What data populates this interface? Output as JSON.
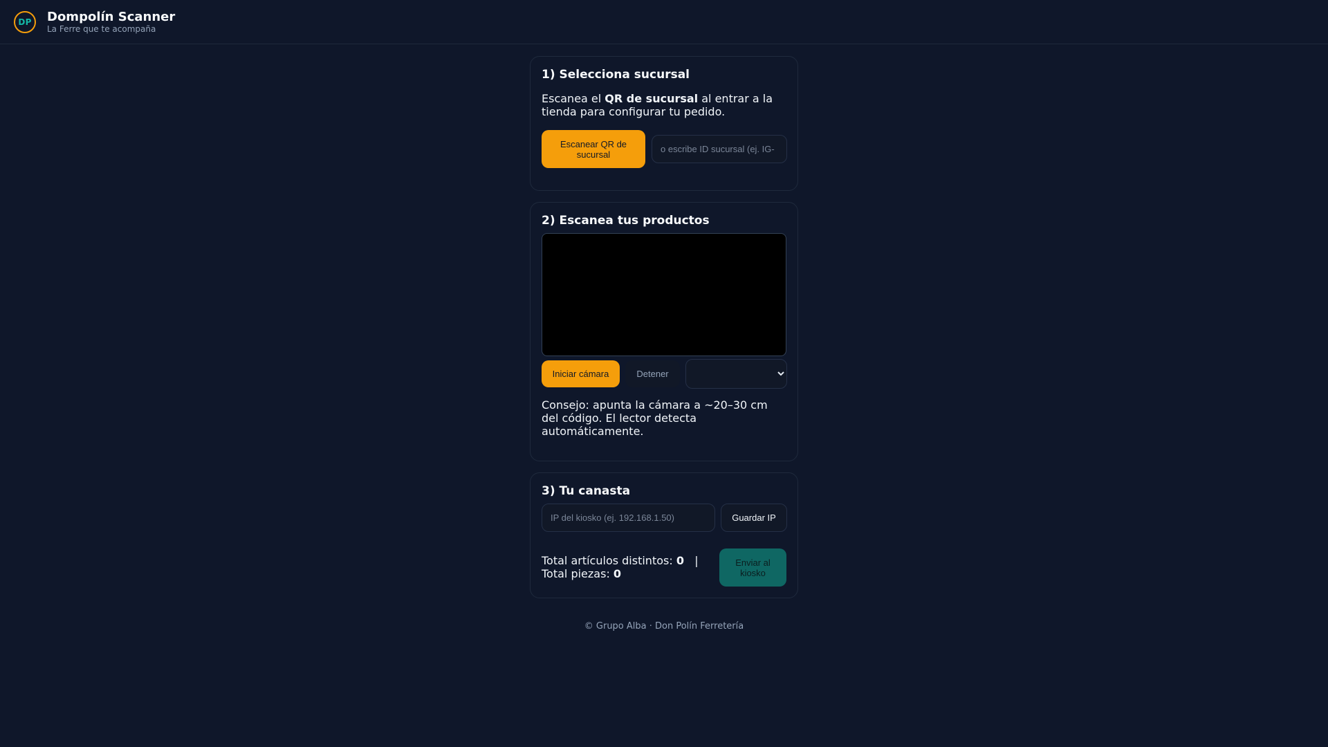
{
  "header": {
    "logo_text": "DP",
    "title": "Dompolín Scanner",
    "subtitle": "La Ferre que te acompaña"
  },
  "branch": {
    "heading": "1) Selecciona sucursal",
    "text_before": "Escanea el ",
    "text_bold": "QR de sucursal",
    "text_after": " al entrar a la tienda para configurar tu pedido.",
    "scan_button": "Escanear QR de sucursal",
    "input_placeholder": "o escribe ID sucursal (ej. IG-"
  },
  "scanner": {
    "heading": "2) Escanea tus productos",
    "start_button": "Iniciar cámara",
    "stop_button": "Detener",
    "camera_selected": "",
    "tip": "Consejo: apunta la cámara a ~20–30 cm del código. El lector detecta automáticamente."
  },
  "basket": {
    "heading": "3) Tu canasta",
    "ip_placeholder": "IP del kiosko (ej. 192.168.1.50)",
    "save_ip_button": "Guardar IP",
    "distinct_label": "Total artículos distintos: ",
    "distinct_value": "0",
    "separator": "|",
    "pieces_label": "Total piezas: ",
    "pieces_value": "0",
    "send_button": "Enviar al kiosko"
  },
  "footer": {
    "text": "© Grupo Alba · Don Polín Ferretería"
  },
  "colors": {
    "background": "#0f172a",
    "accent": "#f59e0b",
    "send_button": "#0f766e",
    "logo_text": "#14b8a6"
  }
}
